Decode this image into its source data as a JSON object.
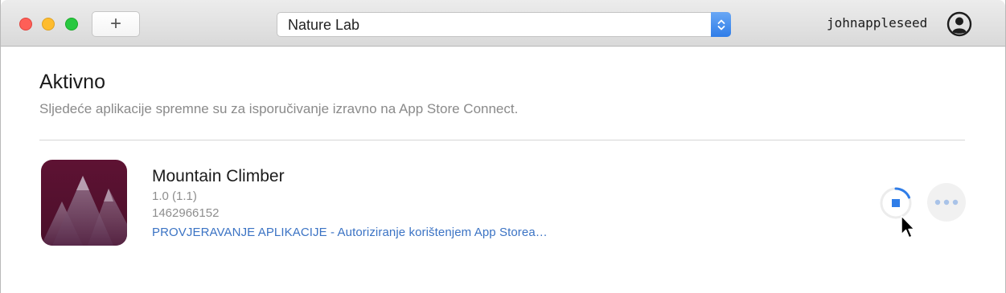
{
  "titlebar": {
    "add_button_label": "+",
    "team_select": {
      "value": "Nature Lab"
    },
    "username": "johnappleseed",
    "account_icon": "person-circle-icon"
  },
  "section": {
    "title": "Aktivno",
    "subtitle": "Sljedeće aplikacije spremne su za isporučivanje izravno na App Store Connect."
  },
  "apps": [
    {
      "icon": "mountain-app-icon",
      "name": "Mountain Climber",
      "version": "1.0 (1.1)",
      "id": "1462966152",
      "status": "PROVJERAVANJE APLIKACIJE - Autoriziranje korištenjem App Storea…",
      "status_color": "#3b73c4"
    }
  ],
  "colors": {
    "accent": "#2f7de8",
    "close": "#fe5f57",
    "minimize": "#febc2e",
    "maximize": "#28c840"
  }
}
